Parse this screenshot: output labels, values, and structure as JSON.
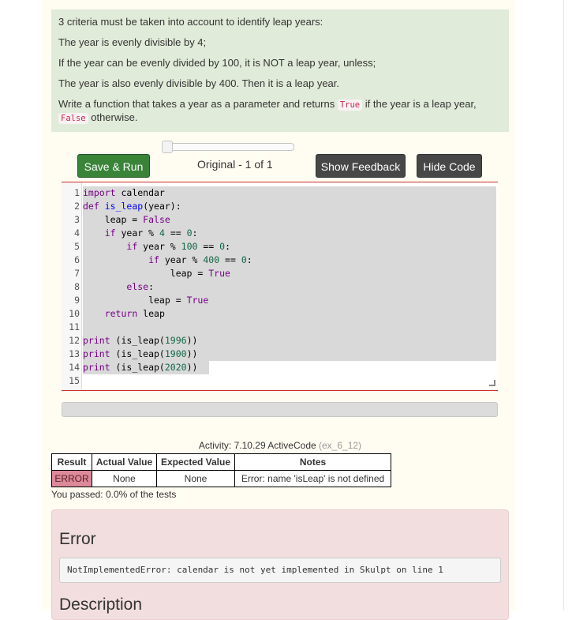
{
  "prompt": {
    "line1": "3 criteria must be taken into account to identify leap years:",
    "line2": "The year is evenly divisible by 4;",
    "line3": "If the year can be evenly divided by 100, it is NOT a leap year, unless;",
    "line4": "The year is also evenly divisible by 400. Then it is a leap year.",
    "line5_before": "Write a function that takes a year as a parameter and returns ",
    "line5_code_true": "True",
    "line5_middle": " if the year is a leap year, ",
    "line5_code_false": "False",
    "line5_after": " otherwise."
  },
  "toolbar": {
    "save_run_label": "Save & Run",
    "version_label": "Original - 1 of 1",
    "show_feedback_label": "Show Feedback",
    "hide_code_label": "Hide Code",
    "slider_value": 0
  },
  "code": {
    "line_numbers": [
      "1",
      "2",
      "3",
      "4",
      "5",
      "6",
      "7",
      "8",
      "9",
      "10",
      "11",
      "12",
      "13",
      "14",
      "15"
    ]
  },
  "activity": {
    "caption": "Activity: 7.10.29 ActiveCode",
    "id": "(ex_6_12)"
  },
  "results": {
    "headers": [
      "Result",
      "Actual Value",
      "Expected Value",
      "Notes"
    ],
    "rows": [
      {
        "result": "ERROR",
        "actual": "None",
        "expected": "None",
        "notes": "Error: name 'isLeap' is not defined"
      }
    ],
    "summary": "You passed: 0.0% of the tests"
  },
  "error": {
    "title": "Error",
    "message": "NotImplementedError: calendar is not yet implemented in Skulpt on line 1",
    "description_title": "Description"
  },
  "colors": {
    "prompt_bg": "#e1ebd9",
    "run_button": "#398439",
    "dark_button": "#474747",
    "error_bg": "#f2dede",
    "fail_cell": "#dc8a9a"
  }
}
